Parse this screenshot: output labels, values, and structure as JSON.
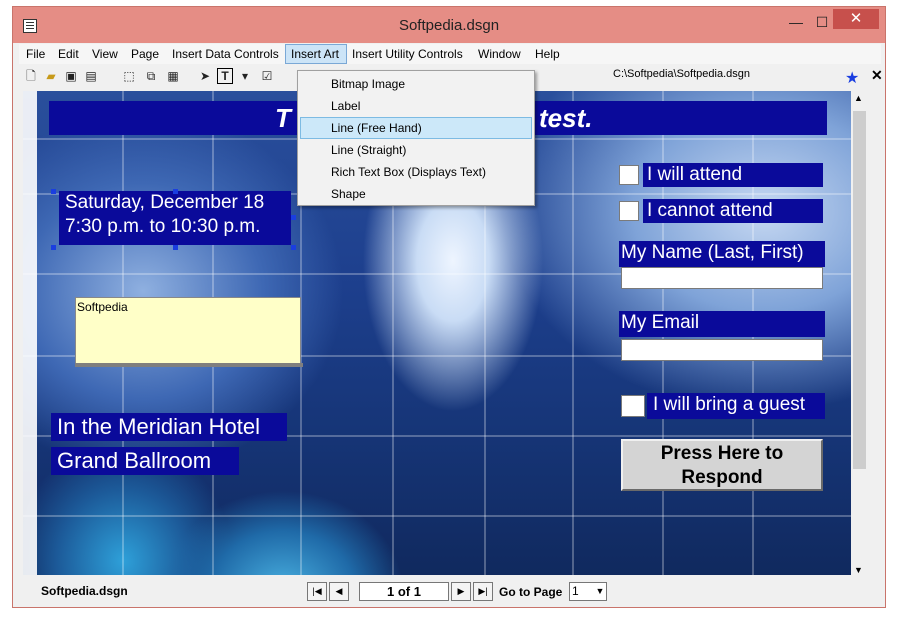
{
  "window": {
    "title": "Softpedia.dsgn"
  },
  "menu": {
    "file": "File",
    "edit": "Edit",
    "view": "View",
    "page": "Page",
    "insert_data_controls": "Insert Data Controls",
    "insert_art": "Insert Art",
    "insert_utility_controls": "Insert Utility Controls",
    "window": "Window",
    "help": "Help"
  },
  "toolbar": {
    "path": "C:\\Softpedia\\Softpedia.dsgn",
    "text_tool_glyph": "T"
  },
  "dropdown": {
    "items": [
      {
        "label": "Bitmap Image"
      },
      {
        "label": "Label"
      },
      {
        "label": "Line (Free Hand)"
      },
      {
        "label": "Line (Straight)"
      },
      {
        "label": "Rich Text Box (Displays Text)"
      },
      {
        "label": "Shape"
      }
    ],
    "highlighted_index": 2
  },
  "canvas": {
    "title_visible_left": "T",
    "title_visible_right": "test.",
    "date_line1": "Saturday, December 18",
    "date_line2": "7:30 p.m. to 10:30 p.m.",
    "textbox_text": "Softpedia",
    "venue_line1": "In the Meridian Hotel",
    "venue_line2": "Grand Ballroom",
    "attend_label": "I will attend",
    "cannot_attend_label": "I cannot attend",
    "name_label": "My Name (Last, First)",
    "email_label": "My Email",
    "guest_label": "I will bring a guest",
    "respond_button": "Press Here to Respond",
    "banner_color": "#0a0a9a"
  },
  "status": {
    "filename": "Softpedia.dsgn",
    "page_indicator": "1 of 1",
    "goto_label": "Go to Page",
    "goto_value": "1"
  },
  "colors": {
    "titlebar": "#e58d85",
    "close_button": "#c7504c",
    "highlight": "#cce8f9"
  }
}
